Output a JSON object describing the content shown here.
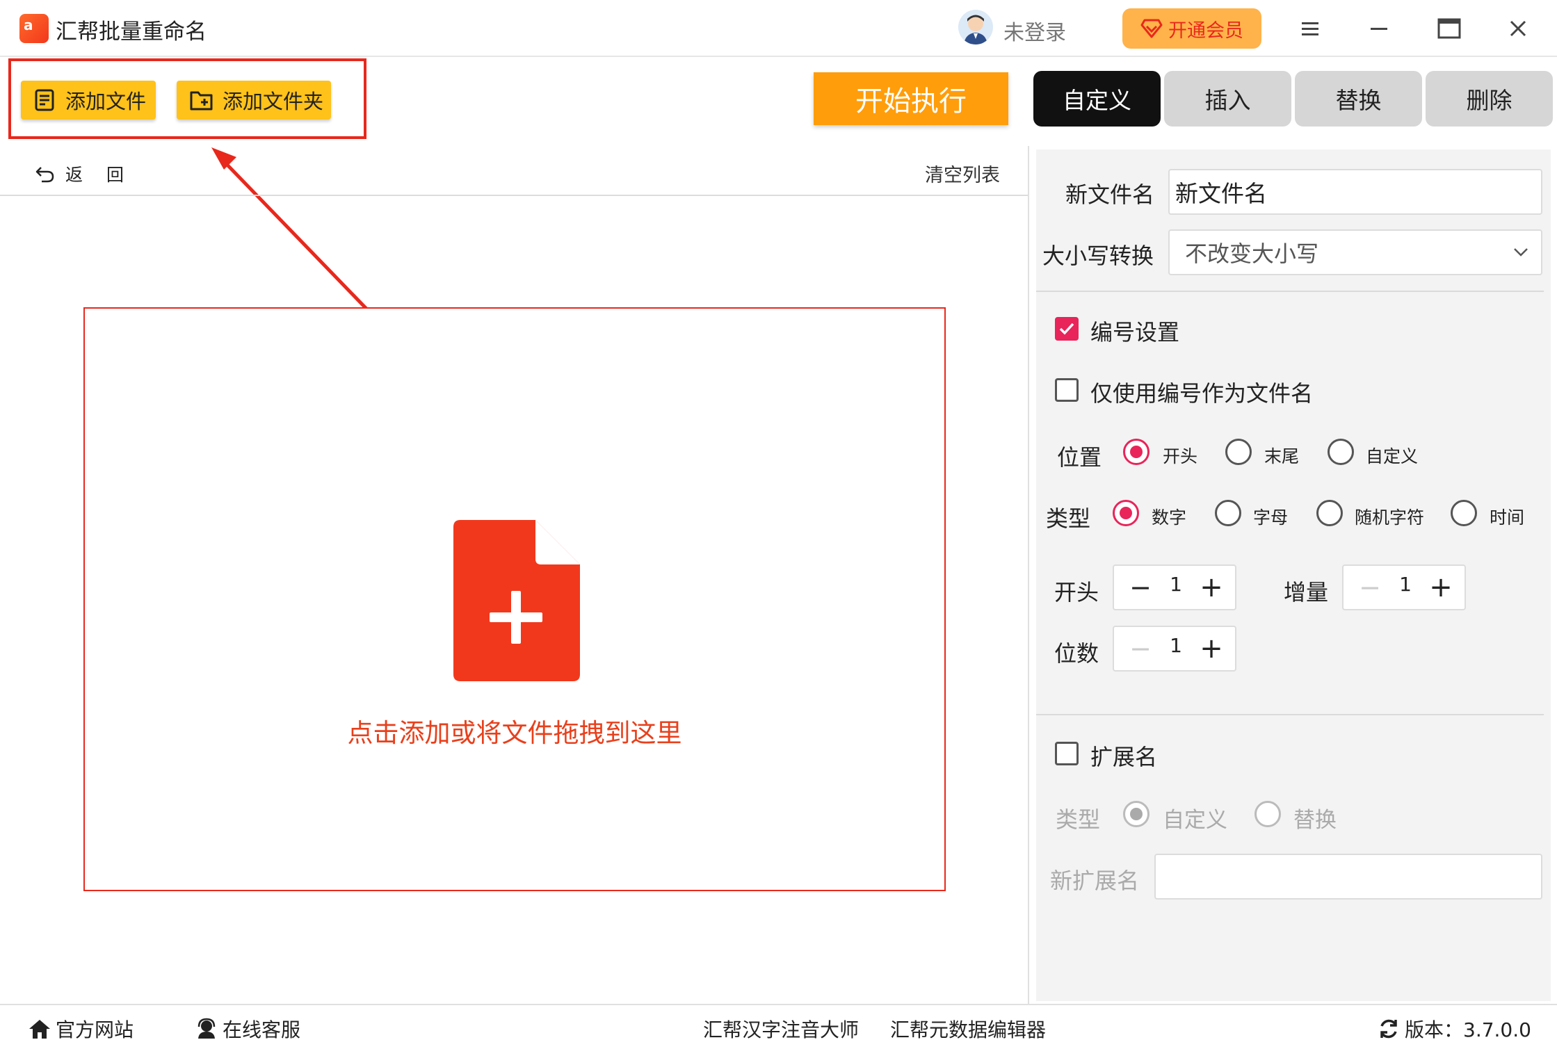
{
  "titlebar": {
    "app_title": "汇帮批量重命名",
    "logo_text": "a",
    "user_text": "未登录",
    "vip_label": "开通会员"
  },
  "toolbar": {
    "add_file_label": "添加文件",
    "add_folder_label": "添加文件夹",
    "start_label": "开始执行"
  },
  "tabs": [
    {
      "label": "自定义",
      "active": true
    },
    {
      "label": "插入",
      "active": false
    },
    {
      "label": "替换",
      "active": false
    },
    {
      "label": "删除",
      "active": false
    }
  ],
  "list": {
    "back_label": "返回",
    "clear_label": "清空列表",
    "drop_text": "点击添加或将文件拖拽到这里"
  },
  "panel": {
    "new_name_label": "新文件名",
    "new_name_value": "新文件名",
    "case_label": "大小写转换",
    "case_value": "不改变大小写",
    "numbering_label": "编号设置",
    "numbering_checked": true,
    "only_number_label": "仅使用编号作为文件名",
    "only_number_checked": false,
    "position_label": "位置",
    "position_options": [
      "开头",
      "末尾",
      "自定义"
    ],
    "position_selected": "开头",
    "type_label": "类型",
    "type_options": [
      "数字",
      "字母",
      "随机字符",
      "时间"
    ],
    "type_selected": "数字",
    "start_label": "开头",
    "start_value": "1",
    "increment_label": "增量",
    "increment_value": "1",
    "digits_label": "位数",
    "digits_value": "1",
    "ext_label": "扩展名",
    "ext_checked": false,
    "ext_type_label": "类型",
    "ext_type_options": [
      "自定义",
      "替换"
    ],
    "ext_type_selected": "自定义",
    "new_ext_label": "新扩展名",
    "new_ext_value": ""
  },
  "footer": {
    "website": "官方网站",
    "support": "在线客服",
    "pinyin_tool": "汇帮汉字注音大师",
    "metadata_tool": "汇帮元数据编辑器",
    "version": "版本：3.7.0.0"
  },
  "colors": {
    "accent_red": "#e8281c",
    "button_yellow": "#ffc21a",
    "start_orange": "#ff9d0a",
    "check_pink": "#e8245a"
  }
}
